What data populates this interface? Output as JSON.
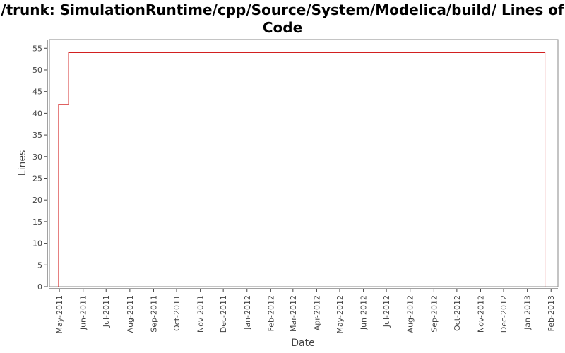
{
  "chart_data": {
    "type": "line",
    "title": "/trunk: SimulationRuntime/cpp/Source/System/Modelica/build/ Lines of Code",
    "xlabel": "Date",
    "ylabel": "Lines",
    "ylim": [
      0,
      57
    ],
    "xlim": [
      "2011-04-18",
      "2013-02-10"
    ],
    "yticks": [
      0,
      5,
      10,
      15,
      20,
      25,
      30,
      35,
      40,
      45,
      50,
      55
    ],
    "xticks": [
      {
        "date": "2011-05-01",
        "label": "May-2011"
      },
      {
        "date": "2011-06-01",
        "label": "Jun-2011"
      },
      {
        "date": "2011-07-01",
        "label": "Jul-2011"
      },
      {
        "date": "2011-08-01",
        "label": "Aug-2011"
      },
      {
        "date": "2011-09-01",
        "label": "Sep-2011"
      },
      {
        "date": "2011-10-01",
        "label": "Oct-2011"
      },
      {
        "date": "2011-11-01",
        "label": "Nov-2011"
      },
      {
        "date": "2011-12-01",
        "label": "Dec-2011"
      },
      {
        "date": "2012-01-01",
        "label": "Jan-2012"
      },
      {
        "date": "2012-02-01",
        "label": "Feb-2012"
      },
      {
        "date": "2012-03-01",
        "label": "Mar-2012"
      },
      {
        "date": "2012-04-01",
        "label": "Apr-2012"
      },
      {
        "date": "2012-05-01",
        "label": "May-2012"
      },
      {
        "date": "2012-06-01",
        "label": "Jun-2012"
      },
      {
        "date": "2012-07-01",
        "label": "Jul-2012"
      },
      {
        "date": "2012-08-01",
        "label": "Aug-2012"
      },
      {
        "date": "2012-09-01",
        "label": "Sep-2012"
      },
      {
        "date": "2012-10-01",
        "label": "Oct-2012"
      },
      {
        "date": "2012-11-01",
        "label": "Nov-2012"
      },
      {
        "date": "2012-12-01",
        "label": "Dec-2012"
      },
      {
        "date": "2013-01-01",
        "label": "Jan-2013"
      },
      {
        "date": "2013-02-01",
        "label": "Feb-2013"
      }
    ],
    "series": [
      {
        "step": true,
        "color": "#cc0000",
        "points": [
          {
            "date": "2011-04-30",
            "value": 0
          },
          {
            "date": "2011-04-30",
            "value": 42
          },
          {
            "date": "2011-05-13",
            "value": 42
          },
          {
            "date": "2011-05-13",
            "value": 54
          },
          {
            "date": "2013-01-24",
            "value": 54
          },
          {
            "date": "2013-01-24",
            "value": 0
          }
        ]
      }
    ],
    "grid": false,
    "legend": "none",
    "colors": {
      "frame": "#888888",
      "tick": "#444444",
      "line": "#cc0000"
    }
  }
}
